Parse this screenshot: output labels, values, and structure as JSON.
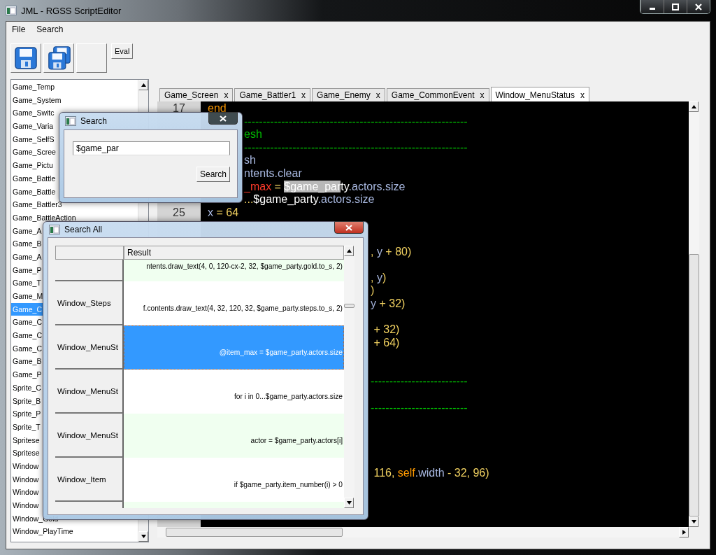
{
  "window": {
    "title": "JML - RGSS ScriptEditor"
  },
  "menu": [
    "File",
    "Search"
  ],
  "toolbar": [
    {
      "kind": "save"
    },
    {
      "kind": "save_all"
    },
    {
      "kind": "blank"
    },
    {
      "kind": "text",
      "label": "Eval"
    }
  ],
  "script_list": {
    "items": [
      {
        "label": "Game_Temp",
        "selected": false
      },
      {
        "label": "Game_System",
        "selected": false
      },
      {
        "label": "Game_Switc",
        "selected": false
      },
      {
        "label": "Game_Varia",
        "selected": false
      },
      {
        "label": "Game_SelfS",
        "selected": false
      },
      {
        "label": "Game_Scree",
        "selected": false
      },
      {
        "label": "Game_Pictu",
        "selected": false
      },
      {
        "label": "Game_Battle",
        "selected": false
      },
      {
        "label": "Game_Battle",
        "selected": false
      },
      {
        "label": "Game_Battler3",
        "selected": false
      },
      {
        "label": "Game_BattleAction",
        "selected": false
      },
      {
        "label": "Game_A",
        "selected": false
      },
      {
        "label": "Game_B",
        "selected": false
      },
      {
        "label": "Game_A",
        "selected": false
      },
      {
        "label": "Game_P",
        "selected": false
      },
      {
        "label": "Game_T",
        "selected": false
      },
      {
        "label": "Game_M",
        "selected": false
      },
      {
        "label": "Game_C",
        "selected": true
      },
      {
        "label": "Game_C",
        "selected": false
      },
      {
        "label": "Game_C",
        "selected": false
      },
      {
        "label": "Game_C",
        "selected": false
      },
      {
        "label": "Game_B",
        "selected": false
      },
      {
        "label": "Game_P",
        "selected": false
      },
      {
        "label": "Sprite_C",
        "selected": false
      },
      {
        "label": "Sprite_B",
        "selected": false
      },
      {
        "label": "Sprite_P",
        "selected": false
      },
      {
        "label": "Sprite_T",
        "selected": false
      },
      {
        "label": "Spritese",
        "selected": false
      },
      {
        "label": "Spritese",
        "selected": false
      },
      {
        "label": "Window",
        "selected": false
      },
      {
        "label": "Window",
        "selected": false
      },
      {
        "label": "Window",
        "selected": false
      },
      {
        "label": "Window",
        "selected": false
      },
      {
        "label": "Window_Gold",
        "selected": false
      },
      {
        "label": "Window_PlayTime",
        "selected": false
      }
    ]
  },
  "tabs": [
    {
      "label": "Game_Screen",
      "close": "x",
      "selected": false
    },
    {
      "label": "Game_Battler1",
      "close": "x",
      "selected": false
    },
    {
      "label": "Game_Enemy",
      "close": "x",
      "selected": false
    },
    {
      "label": "Game_CommonEvent",
      "close": "x",
      "selected": false
    },
    {
      "label": "Window_MenuStatus",
      "close": "x",
      "selected": true
    }
  ],
  "editor": {
    "lines": [
      {
        "kind": "full",
        "number": "17",
        "segments": [
          {
            "kind": "keyword",
            "text": "end"
          }
        ]
      },
      {
        "kind": "behind_search",
        "segments": [
          {
            "kind": "comment",
            "text": "------------------------------------------------------------"
          }
        ]
      },
      {
        "kind": "behind_search",
        "segments": [
          {
            "kind": "comment",
            "text": "esh"
          }
        ]
      },
      {
        "kind": "behind_search",
        "segments": [
          {
            "kind": "comment",
            "text": "------------------------------------------------------------"
          }
        ]
      },
      {
        "kind": "behind_search",
        "segments": [
          {
            "kind": "ident",
            "text": "sh"
          }
        ]
      },
      {
        "kind": "behind_search",
        "segments": [
          {
            "kind": "ident",
            "text": "ntents.clear"
          }
        ]
      },
      {
        "kind": "behind_search",
        "segments": [
          {
            "kind": "ivar",
            "text": "_max"
          },
          {
            "kind": "number",
            "text": " = "
          },
          {
            "kind": "selection",
            "text": "$game_par"
          },
          {
            "kind": "global",
            "text": "ty"
          },
          {
            "kind": "ident",
            "text": ".actors.size"
          }
        ]
      },
      {
        "kind": "behind_search",
        "segments": [
          {
            "kind": "number",
            "text": "..."
          },
          {
            "kind": "global",
            "text": "$game_party"
          },
          {
            "kind": "ident",
            "text": ".actors.size"
          }
        ]
      },
      {
        "kind": "full",
        "number": "25",
        "segments": [
          {
            "kind": "ident",
            "text": "x"
          },
          {
            "kind": "number",
            "text": " = 64"
          }
        ]
      },
      {
        "kind": "blank"
      },
      {
        "kind": "blank"
      },
      {
        "kind": "behind_results",
        "segments": [
          {
            "kind": "number",
            "text": ", "
          },
          {
            "kind": "ident",
            "text": "y"
          },
          {
            "kind": "number",
            "text": " + 80)"
          }
        ]
      },
      {
        "kind": "blank"
      },
      {
        "kind": "behind_results",
        "segments": [
          {
            "kind": "number",
            "text": ", "
          },
          {
            "kind": "ident",
            "text": "y"
          },
          {
            "kind": "number",
            "text": ")"
          }
        ]
      },
      {
        "kind": "behind_results",
        "segments": [
          {
            "kind": "number",
            "text": ")"
          }
        ]
      },
      {
        "kind": "behind_results",
        "segments": [
          {
            "kind": "ident",
            "text": "y"
          },
          {
            "kind": "number",
            "text": " + 32)"
          }
        ]
      },
      {
        "kind": "blank"
      },
      {
        "kind": "behind_results",
        "segments": [
          {
            "kind": "number",
            "text": " + 32)"
          }
        ]
      },
      {
        "kind": "behind_results",
        "segments": [
          {
            "kind": "number",
            "text": " + 64)"
          }
        ]
      },
      {
        "kind": "blank"
      },
      {
        "kind": "blank"
      },
      {
        "kind": "behind_results",
        "segments": [
          {
            "kind": "comment",
            "text": "--------------------------"
          }
        ]
      },
      {
        "kind": "blank"
      },
      {
        "kind": "behind_results",
        "segments": [
          {
            "kind": "comment",
            "text": "--------------------------"
          }
        ]
      },
      {
        "kind": "blank"
      },
      {
        "kind": "blank"
      },
      {
        "kind": "blank"
      },
      {
        "kind": "blank"
      },
      {
        "kind": "behind_results",
        "segments": [
          {
            "kind": "number",
            "text": " 116, "
          },
          {
            "kind": "keyword",
            "text": "self"
          },
          {
            "kind": "ident",
            "text": ".width"
          },
          {
            "kind": "number",
            "text": " - 32, 96)"
          }
        ]
      }
    ]
  },
  "search_dialog": {
    "title": "Search",
    "query": "$game_par",
    "button": "Search"
  },
  "search_all_dialog": {
    "title": "Search All",
    "result_header": "Result",
    "rows": [
      {
        "kind": "clipped",
        "result": "ntents.draw_text(4, 0, 120-cx-2, 32, $game_party.gold.to_s, 2)",
        "selected": false
      },
      {
        "kind": "full",
        "name": "Window_Steps",
        "result": "f.contents.draw_text(4, 32, 120, 32, $game_party.steps.to_s, 2)",
        "selected": false
      },
      {
        "kind": "full",
        "name": "Window_MenuSt",
        "result": "@item_max = $game_party.actors.size",
        "selected": true
      },
      {
        "kind": "full",
        "name": "Window_MenuSt",
        "result": "for i in 0...$game_party.actors.size",
        "selected": false
      },
      {
        "kind": "full",
        "name": "Window_MenuSt",
        "result": "actor = $game_party.actors[i]",
        "selected": false
      },
      {
        "kind": "full",
        "name": "Window_Item",
        "result": "if $game_party.item_number(i) > 0",
        "selected": false
      }
    ]
  }
}
